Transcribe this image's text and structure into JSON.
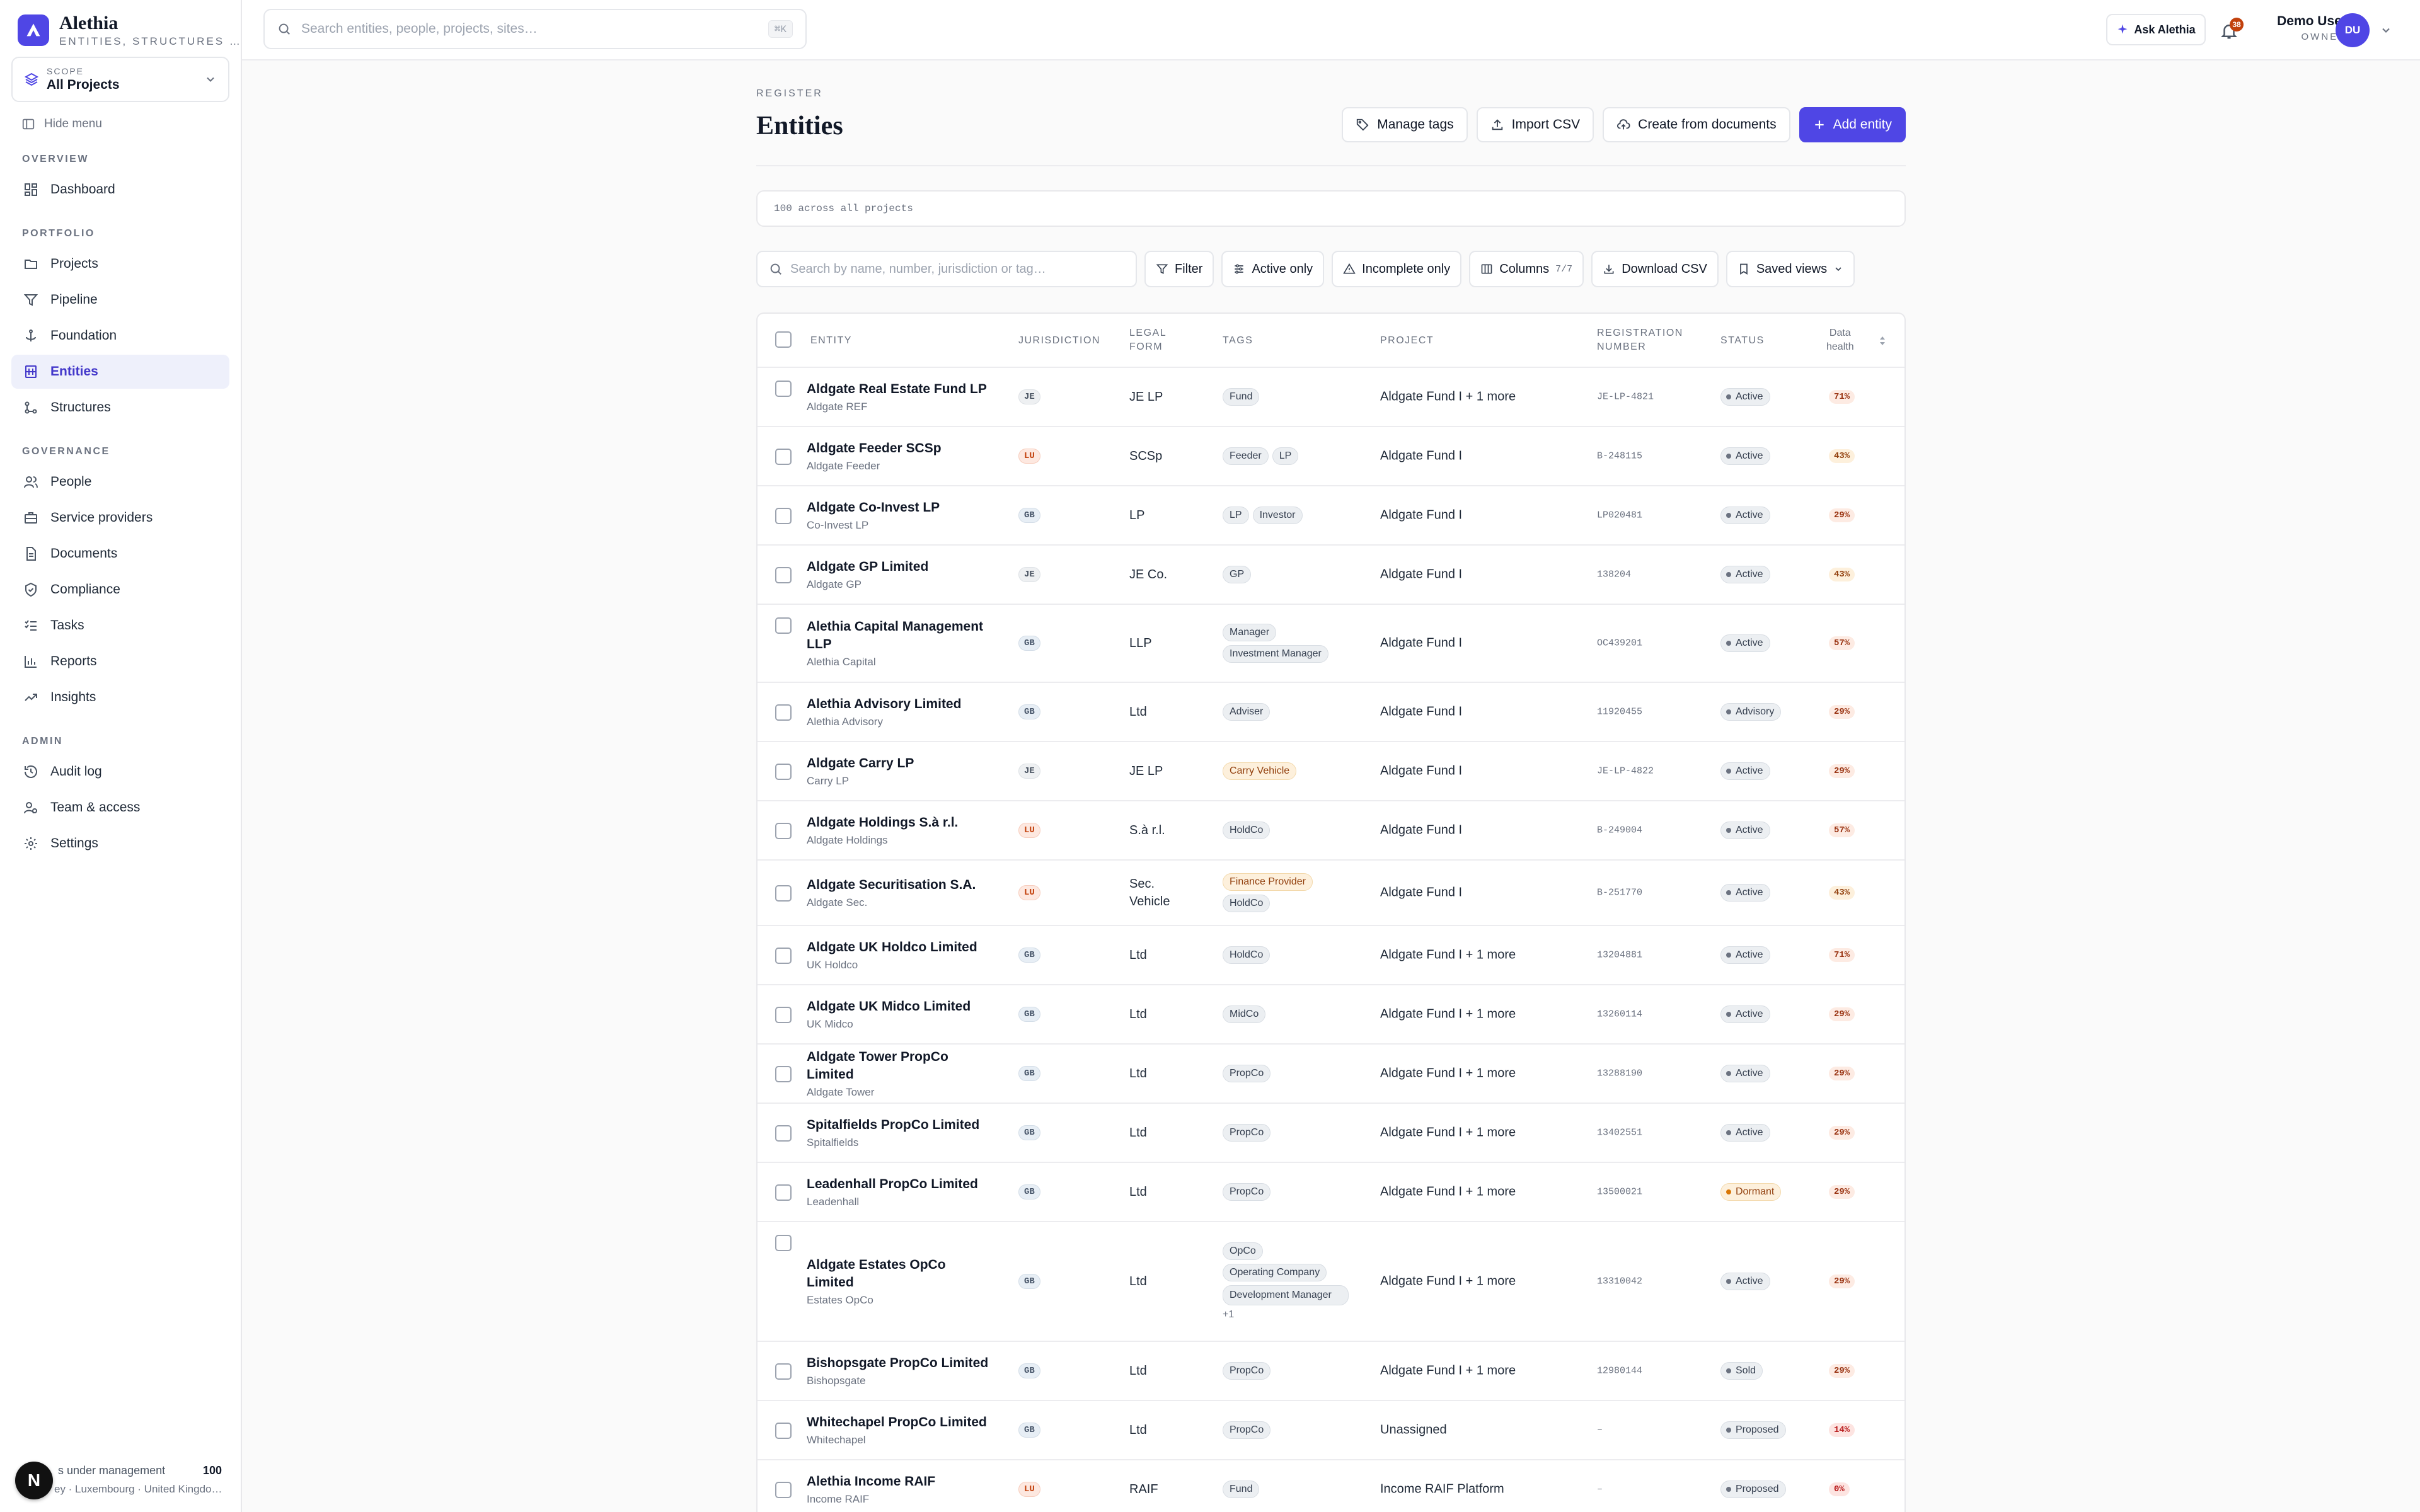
{
  "brand": {
    "name": "Alethia",
    "tagline": "ENTITIES, STRUCTURES …"
  },
  "scope": {
    "label": "SCOPE",
    "value": "All Projects"
  },
  "sidebar": {
    "hide_menu": "Hide menu",
    "sections": [
      {
        "label": "OVERVIEW",
        "items": [
          {
            "label": "Dashboard",
            "icon": "dashboard-icon"
          }
        ]
      },
      {
        "label": "PORTFOLIO",
        "items": [
          {
            "label": "Projects",
            "icon": "folder-icon"
          },
          {
            "label": "Pipeline",
            "icon": "funnel-icon"
          },
          {
            "label": "Foundation",
            "icon": "anchor-icon"
          },
          {
            "label": "Entities",
            "icon": "building-icon",
            "active": true
          },
          {
            "label": "Structures",
            "icon": "structure-icon"
          }
        ]
      },
      {
        "label": "GOVERNANCE",
        "items": [
          {
            "label": "People",
            "icon": "people-icon"
          },
          {
            "label": "Service providers",
            "icon": "briefcase-icon"
          },
          {
            "label": "Documents",
            "icon": "document-icon"
          },
          {
            "label": "Compliance",
            "icon": "shield-icon"
          },
          {
            "label": "Tasks",
            "icon": "tasks-icon"
          },
          {
            "label": "Reports",
            "icon": "bar-chart-icon"
          },
          {
            "label": "Insights",
            "icon": "trend-icon"
          }
        ]
      },
      {
        "label": "ADMIN",
        "items": [
          {
            "label": "Audit log",
            "icon": "history-icon"
          },
          {
            "label": "Team & access",
            "icon": "team-icon"
          },
          {
            "label": "Settings",
            "icon": "gear-icon"
          }
        ]
      }
    ],
    "footer": {
      "line1": "s under management",
      "count": "100",
      "line2": "ey · Luxembourg · United Kingdo…",
      "badge": "N"
    }
  },
  "topbar": {
    "search_placeholder": "Search entities, people, projects, sites…",
    "shortcut": "⌘K",
    "ask": "Ask Alethia",
    "notif_count": "38",
    "user_name": "Demo User",
    "user_role": "OWNER",
    "avatar": "DU"
  },
  "page": {
    "eyebrow": "REGISTER",
    "title": "Entities",
    "summary": "100 across all projects"
  },
  "actions": {
    "manage_tags": "Manage tags",
    "import_csv": "Import CSV",
    "create_docs": "Create from documents",
    "add_entity": "Add entity"
  },
  "toolbar": {
    "search_placeholder": "Search by name, number, jurisdiction or tag…",
    "filter": "Filter",
    "active_only": "Active only",
    "incomplete_only": "Incomplete only",
    "columns": "Columns",
    "columns_count": "7/7",
    "download": "Download CSV",
    "saved_views": "Saved views"
  },
  "columns": {
    "entity": "ENTITY",
    "jurisdiction": "JURISDICTION",
    "legal_form_1": "LEGAL",
    "legal_form_2": "FORM",
    "tags": "TAGS",
    "project": "PROJECT",
    "reg_1": "REGISTRATION",
    "reg_2": "NUMBER",
    "status": "STATUS",
    "health_1": "Data",
    "health_2": "health"
  },
  "rows": [
    {
      "name": "Aldgate Real Estate Fund LP",
      "sub": "Aldgate REF",
      "jur": "JE",
      "form": "JE LP",
      "tags": [
        "Fund"
      ],
      "project": "Aldgate Fund I + 1 more",
      "reg": "JE-LP-4821",
      "status": "Active",
      "health": "71%"
    },
    {
      "name": "Aldgate Feeder SCSp",
      "sub": "Aldgate Feeder",
      "jur": "LU",
      "form": "SCSp",
      "tags": [
        "Feeder",
        "LP"
      ],
      "project": "Aldgate Fund I",
      "reg": "B-248115",
      "status": "Active",
      "health": "43%"
    },
    {
      "name": "Aldgate Co-Invest LP",
      "sub": "Co-Invest LP",
      "jur": "GB",
      "form": "LP",
      "tags": [
        "LP",
        "Investor"
      ],
      "project": "Aldgate Fund I",
      "reg": "LP020481",
      "status": "Active",
      "health": "29%"
    },
    {
      "name": "Aldgate GP Limited",
      "sub": "Aldgate GP",
      "jur": "JE",
      "form": "JE Co.",
      "tags": [
        "GP"
      ],
      "project": "Aldgate Fund I",
      "reg": "138204",
      "status": "Active",
      "health": "43%"
    },
    {
      "name": "Alethia Capital Management LLP",
      "sub": "Alethia Capital",
      "jur": "GB",
      "form": "LLP",
      "tags": [
        "Manager",
        "Investment Manager"
      ],
      "project": "Aldgate Fund I",
      "reg": "OC439201",
      "status": "Active",
      "health": "57%"
    },
    {
      "name": "Alethia Advisory Limited",
      "sub": "Alethia Advisory",
      "jur": "GB",
      "form": "Ltd",
      "tags": [
        "Adviser"
      ],
      "project": "Aldgate Fund I",
      "reg": "11920455",
      "status": "Advisory",
      "health": "29%"
    },
    {
      "name": "Aldgate Carry LP",
      "sub": "Carry LP",
      "jur": "JE",
      "form": "JE LP",
      "tags": [
        "Carry Vehicle"
      ],
      "project": "Aldgate Fund I",
      "reg": "JE-LP-4822",
      "status": "Active",
      "health": "29%"
    },
    {
      "name": "Aldgate Holdings S.à r.l.",
      "sub": "Aldgate Holdings",
      "jur": "LU",
      "form": "S.à r.l.",
      "tags": [
        "HoldCo"
      ],
      "project": "Aldgate Fund I",
      "reg": "B-249004",
      "status": "Active",
      "health": "57%"
    },
    {
      "name": "Aldgate Securitisation S.A.",
      "sub": "Aldgate Sec.",
      "jur": "LU",
      "form": "Sec. Vehicle",
      "tags": [
        "Finance Provider",
        "HoldCo"
      ],
      "project": "Aldgate Fund I",
      "reg": "B-251770",
      "status": "Active",
      "health": "43%"
    },
    {
      "name": "Aldgate UK Holdco Limited",
      "sub": "UK Holdco",
      "jur": "GB",
      "form": "Ltd",
      "tags": [
        "HoldCo"
      ],
      "project": "Aldgate Fund I + 1 more",
      "reg": "13204881",
      "status": "Active",
      "health": "71%"
    },
    {
      "name": "Aldgate UK Midco Limited",
      "sub": "UK Midco",
      "jur": "GB",
      "form": "Ltd",
      "tags": [
        "MidCo"
      ],
      "project": "Aldgate Fund I + 1 more",
      "reg": "13260114",
      "status": "Active",
      "health": "29%"
    },
    {
      "name": "Aldgate Tower PropCo Limited",
      "sub": "Aldgate Tower",
      "jur": "GB",
      "form": "Ltd",
      "tags": [
        "PropCo"
      ],
      "project": "Aldgate Fund I + 1 more",
      "reg": "13288190",
      "status": "Active",
      "health": "29%"
    },
    {
      "name": "Spitalfields PropCo Limited",
      "sub": "Spitalfields",
      "jur": "GB",
      "form": "Ltd",
      "tags": [
        "PropCo"
      ],
      "project": "Aldgate Fund I + 1 more",
      "reg": "13402551",
      "status": "Active",
      "health": "29%"
    },
    {
      "name": "Leadenhall PropCo Limited",
      "sub": "Leadenhall",
      "jur": "GB",
      "form": "Ltd",
      "tags": [
        "PropCo"
      ],
      "project": "Aldgate Fund I + 1 more",
      "reg": "13500021",
      "status": "Dormant",
      "health": "29%"
    },
    {
      "name": "Aldgate Estates OpCo Limited",
      "sub": "Estates OpCo",
      "jur": "GB",
      "form": "Ltd",
      "tags": [
        "OpCo",
        "Operating Company",
        "Development Manager"
      ],
      "more": "+1",
      "project": "Aldgate Fund I + 1 more",
      "reg": "13310042",
      "status": "Active",
      "health": "29%"
    },
    {
      "name": "Bishopsgate PropCo Limited",
      "sub": "Bishopsgate",
      "jur": "GB",
      "form": "Ltd",
      "tags": [
        "PropCo"
      ],
      "project": "Aldgate Fund I + 1 more",
      "reg": "12980144",
      "status": "Sold",
      "health": "29%"
    },
    {
      "name": "Whitechapel PropCo Limited",
      "sub": "Whitechapel",
      "jur": "GB",
      "form": "Ltd",
      "tags": [
        "PropCo"
      ],
      "project": "Unassigned",
      "reg": "–",
      "status": "Proposed",
      "health": "14%"
    },
    {
      "name": "Alethia Income RAIF",
      "sub": "Income RAIF",
      "jur": "LU",
      "form": "RAIF",
      "tags": [
        "Fund"
      ],
      "project": "Income RAIF Platform",
      "reg": "–",
      "status": "Proposed",
      "health": "0%"
    }
  ]
}
